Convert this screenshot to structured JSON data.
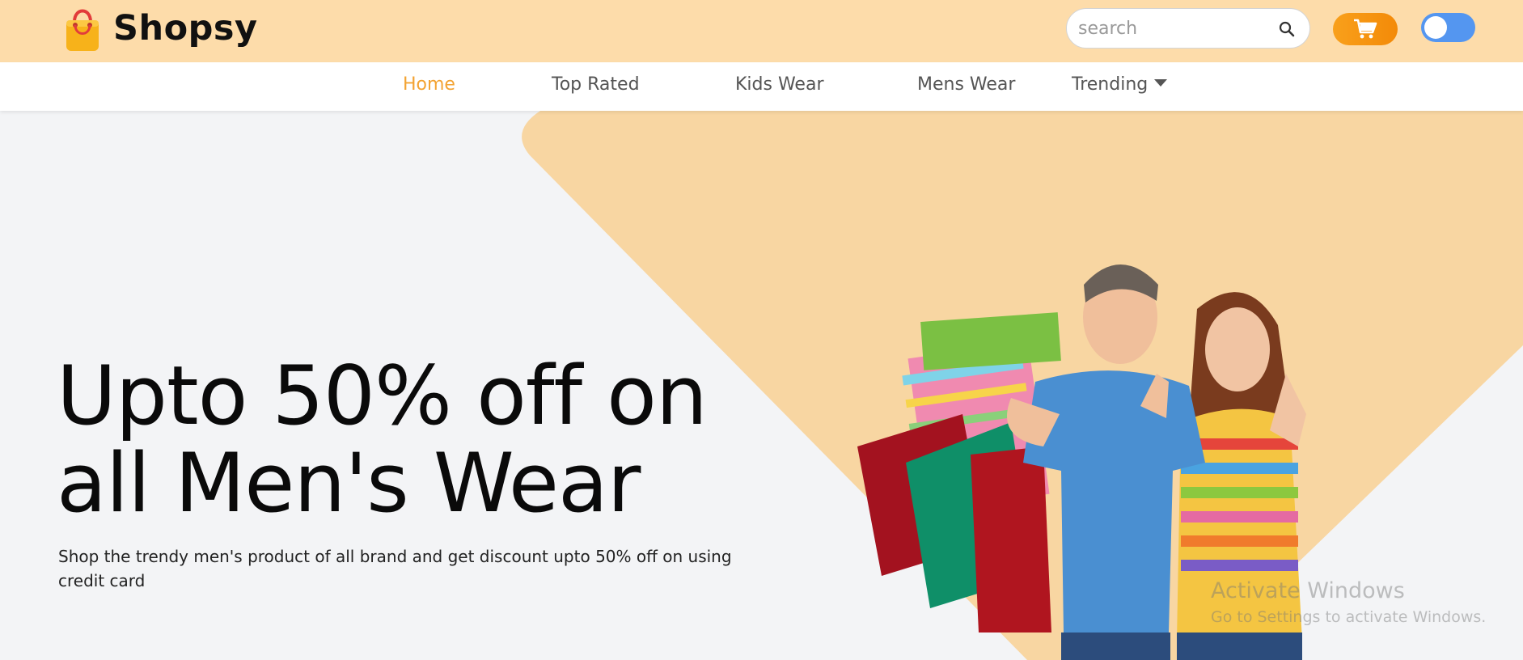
{
  "brand": {
    "name": "Shopsy",
    "colors": {
      "header_bg": "#fddcaa",
      "accent": "#f3a333",
      "toggle": "#5496f0",
      "cart": "#f38a08"
    }
  },
  "header": {
    "search": {
      "placeholder": "search",
      "value": "",
      "icon": "search-icon"
    },
    "cart": {
      "icon": "cart-icon"
    },
    "theme_toggle": {
      "state": "off"
    }
  },
  "nav": {
    "items": [
      {
        "label": "Home",
        "active": true
      },
      {
        "label": "Top Rated",
        "active": false
      },
      {
        "label": "Kids Wear",
        "active": false
      },
      {
        "label": "Mens Wear",
        "active": false
      },
      {
        "label": "Trending",
        "active": false,
        "has_dropdown": true
      }
    ]
  },
  "hero": {
    "title_line1": "Upto 50% off on",
    "title_line2": "all Men's Wear",
    "subtitle": "Shop the trendy men's product of all brand and get discount upto 50% off on using credit card"
  },
  "watermark": {
    "title": "Activate Windows",
    "subtitle": "Go to Settings to activate Windows."
  }
}
